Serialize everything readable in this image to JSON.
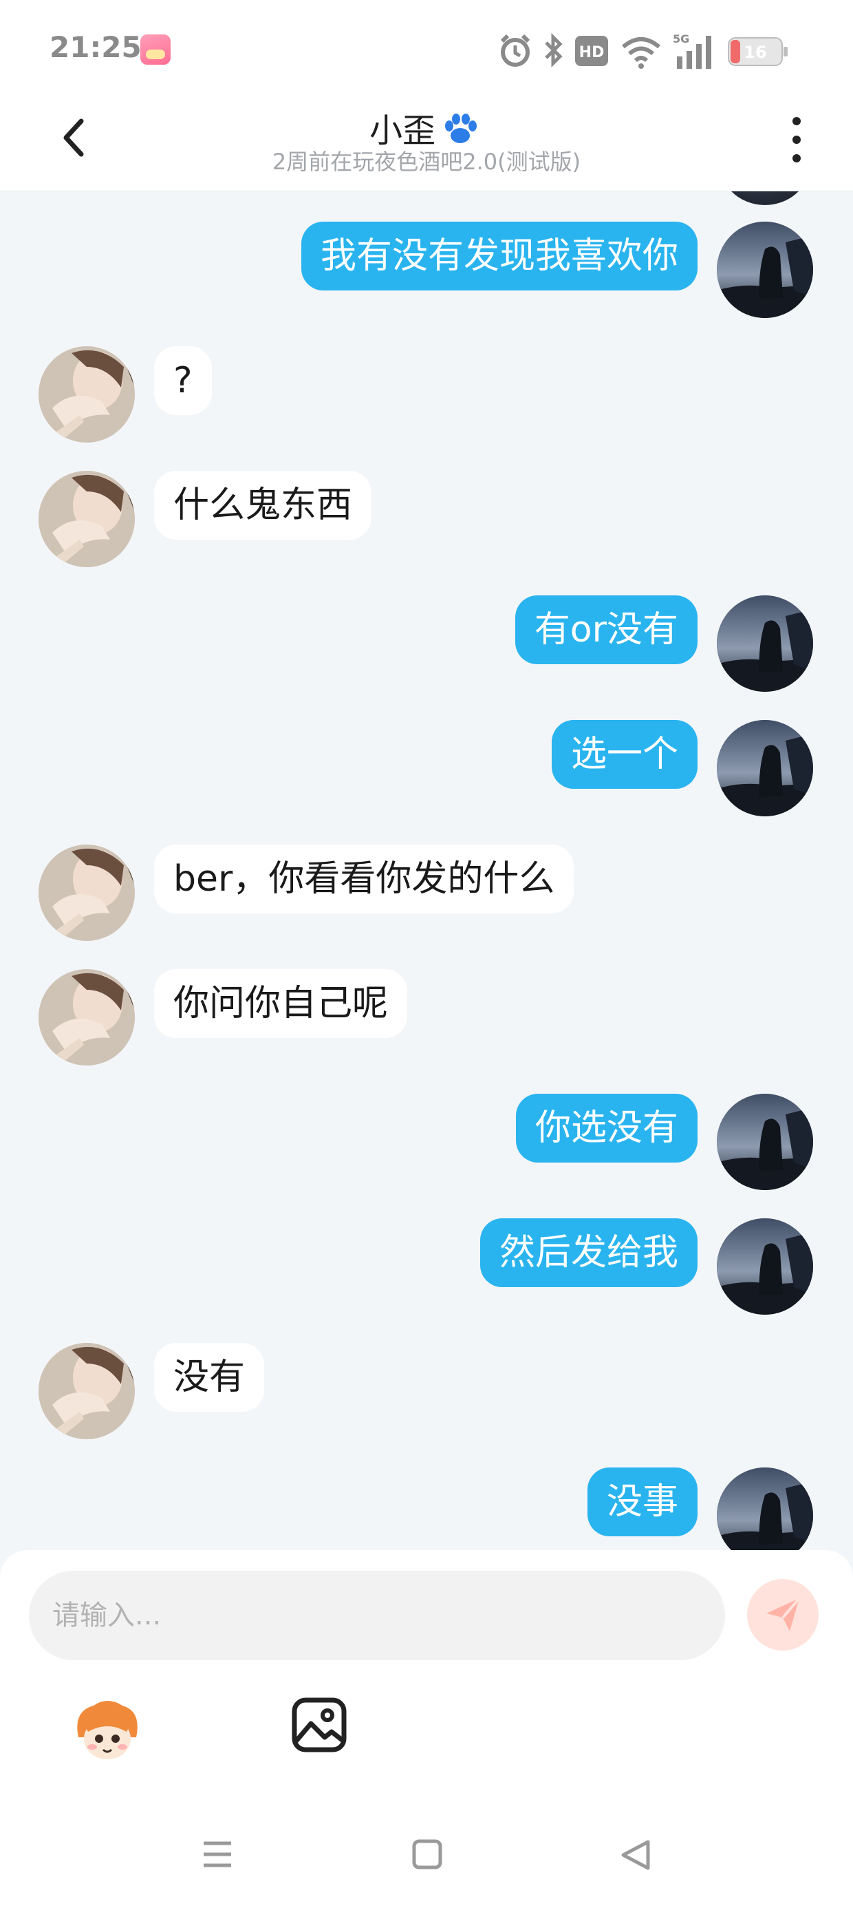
{
  "status_bar": {
    "time": "21:25",
    "network": "5G",
    "hd_label": "HD",
    "battery": "16",
    "icons": [
      "app-notification-icon",
      "alarm-icon",
      "bluetooth-icon",
      "hd-icon",
      "wifi-icon",
      "signal-icon",
      "battery-icon"
    ]
  },
  "header": {
    "title": "小歪",
    "subtitle": "2周前在玩夜色酒吧2.0(测试版)",
    "icons": [
      "back-icon",
      "paw-icon",
      "more-icon"
    ]
  },
  "messages": [
    {
      "sender": "me",
      "text": "我有没有发现我喜欢你"
    },
    {
      "sender": "them",
      "text": "?"
    },
    {
      "sender": "them",
      "text": "什么鬼东西"
    },
    {
      "sender": "me",
      "text": "有or没有"
    },
    {
      "sender": "me",
      "text": "选一个"
    },
    {
      "sender": "them",
      "text": "ber，你看看你发的什么"
    },
    {
      "sender": "them",
      "text": "你问你自己呢"
    },
    {
      "sender": "me",
      "text": "你选没有"
    },
    {
      "sender": "me",
      "text": "然后发给我"
    },
    {
      "sender": "them",
      "text": "没有"
    },
    {
      "sender": "me",
      "text": "没事"
    }
  ],
  "input": {
    "placeholder": "请输入...",
    "value": ""
  },
  "toolbar": {
    "icons": [
      "send-icon",
      "sticker-icon",
      "image-icon"
    ]
  },
  "nav_bar": {
    "icons": [
      "menu-icon",
      "home-icon",
      "back-triangle-icon"
    ]
  },
  "colors": {
    "background": "#f3f6f9",
    "my_bubble": "#2ab4ef",
    "their_bubble": "#ffffff",
    "send_button": "#ffe2dc",
    "send_icon": "#ffb3a6"
  }
}
